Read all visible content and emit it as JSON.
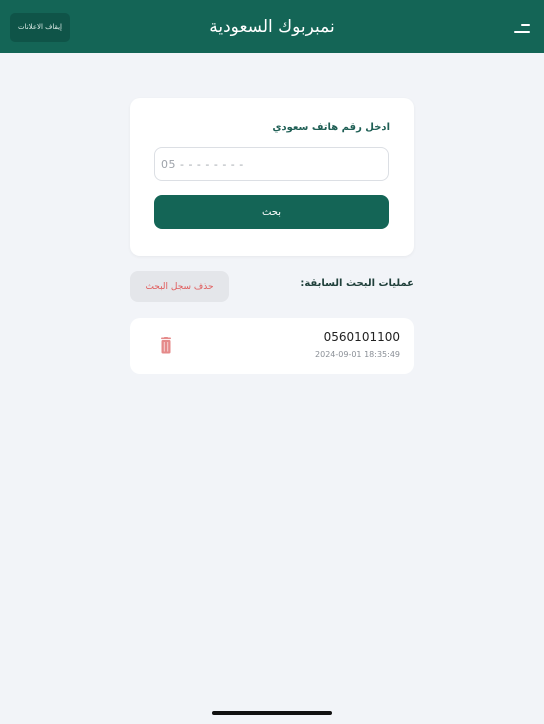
{
  "header": {
    "title": "نمبربوك السعودية",
    "ads_button_label": "إيقاف الاعلانات",
    "menu_icon": "menu-icon"
  },
  "search": {
    "label": "ادخل رقم هاتف سعودي",
    "placeholder": "05 - - - - - - - -",
    "value": "",
    "button_label": "بحث"
  },
  "history": {
    "title": "عمليات البحث السابقة:",
    "clear_button_label": "حذف سجل البحث",
    "items": [
      {
        "phone": "0560101100",
        "timestamp": "2024-09-01 18:35:49",
        "delete_icon": "trash-icon"
      }
    ]
  },
  "colors": {
    "primary": "#146556",
    "background": "#f2f4f8",
    "danger": "#e05a5a"
  }
}
